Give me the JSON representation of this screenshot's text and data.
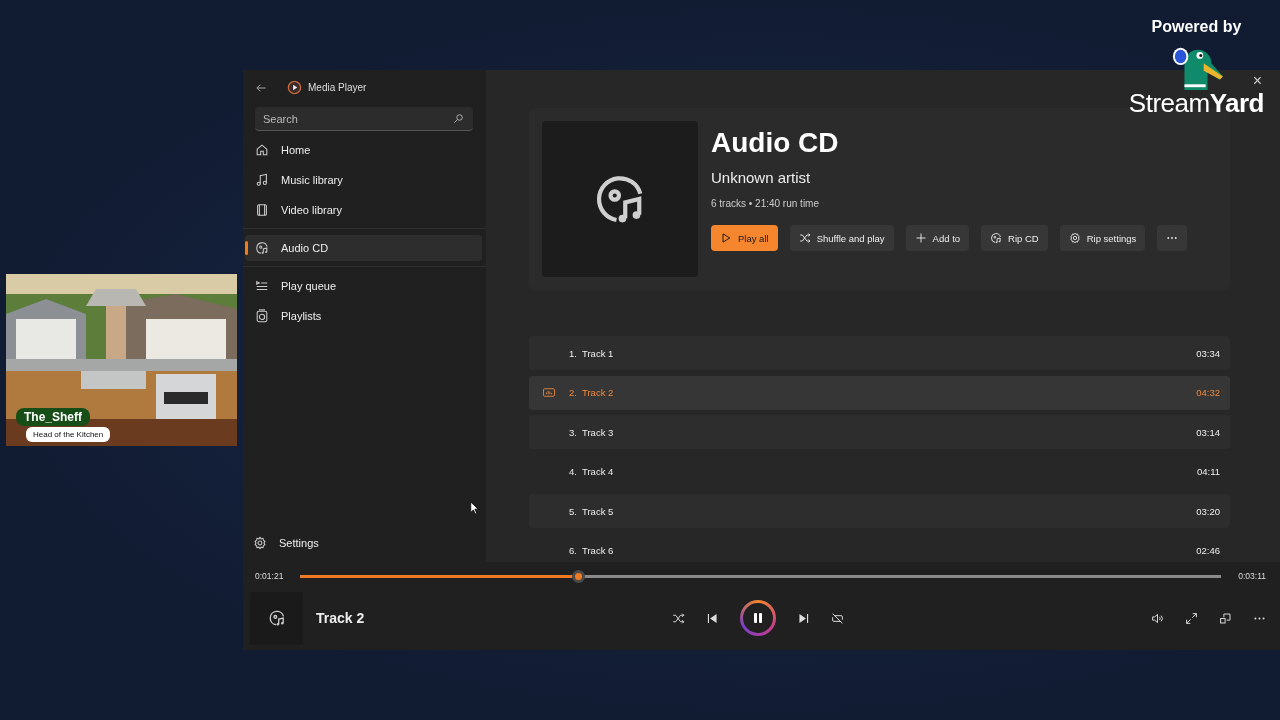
{
  "stream": {
    "powered_by": "Powered by",
    "brand": "Stream**Yard**"
  },
  "camera": {
    "name": "The_Sheff",
    "title": "Head of the Kitchen"
  },
  "window": {
    "app_title": "Media Player",
    "close": "×"
  },
  "search": {
    "placeholder": "Search"
  },
  "nav_sections": [
    [
      {
        "label": "Home",
        "kind": "home",
        "selected": false
      },
      {
        "label": "Music library",
        "kind": "music",
        "selected": false
      },
      {
        "label": "Video library",
        "kind": "video",
        "selected": false
      }
    ],
    [
      {
        "label": "Audio CD",
        "kind": "cd",
        "selected": true
      }
    ],
    [
      {
        "label": "Play queue",
        "kind": "queue",
        "selected": false
      },
      {
        "label": "Playlists",
        "kind": "playlist",
        "selected": false
      }
    ]
  ],
  "settings": {
    "label": "Settings"
  },
  "album": {
    "title": "Audio CD",
    "artist": "Unknown artist",
    "meta": "6 tracks • 21:40 run time"
  },
  "actions": [
    {
      "label": "Play all",
      "kind": "play",
      "primary": true
    },
    {
      "label": "Shuffle and play",
      "kind": "shuffle",
      "primary": false
    },
    {
      "label": "Add to",
      "kind": "plus",
      "primary": false
    },
    {
      "label": "Rip CD",
      "kind": "cd",
      "primary": false
    },
    {
      "label": "Rip settings",
      "kind": "gear",
      "primary": false
    },
    {
      "kind": "more",
      "primary": false
    }
  ],
  "tracks": [
    {
      "number": "1.",
      "title": "Track 1",
      "duration": "03:34",
      "playing": false
    },
    {
      "number": "2.",
      "title": "Track 2",
      "duration": "04:32",
      "playing": true
    },
    {
      "number": "3.",
      "title": "Track 3",
      "duration": "03:14",
      "playing": false
    },
    {
      "number": "4.",
      "title": "Track 4",
      "duration": "04:11",
      "playing": false
    },
    {
      "number": "5.",
      "title": "Track 5",
      "duration": "03:20",
      "playing": false
    },
    {
      "number": "6.",
      "title": "Track 6",
      "duration": "02:46",
      "playing": false
    }
  ],
  "player": {
    "elapsed": "0:01:21",
    "total": "0:03:11",
    "level": 0.302,
    "track": "Track 2",
    "playing": true
  }
}
